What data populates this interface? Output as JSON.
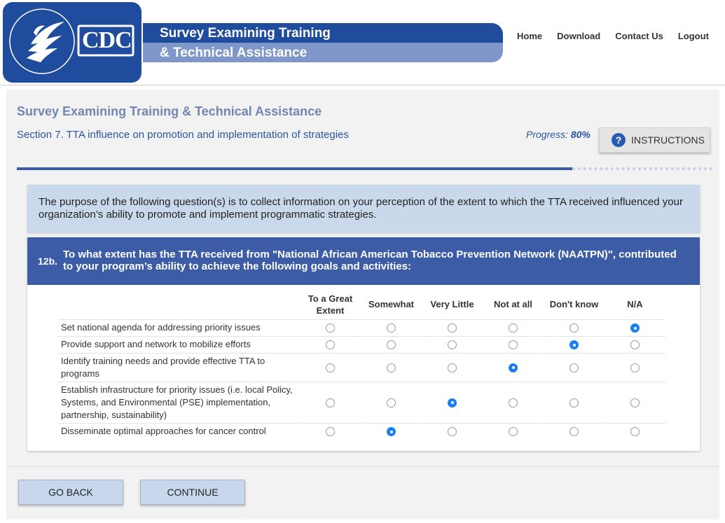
{
  "header": {
    "logo_alt": "HHS / CDC",
    "logo_text": "CDC",
    "seal_text": "DEPARTMENT OF HEALTH & HUMAN SERVICES USA",
    "banner_line1": "Survey Examining Training",
    "banner_line2": "& Technical Assistance",
    "nav": [
      "Home",
      "Download",
      "Contact Us",
      "Logout"
    ]
  },
  "page": {
    "title": "Survey Examining Training & Technical Assistance",
    "section": "Section 7. TTA influence on promotion and implementation of strategies",
    "progress_label": "Progress:",
    "progress_value": "80%",
    "progress_fraction": 0.8,
    "instructions_label": "INSTRUCTIONS",
    "instructions_icon": "question-circle-icon"
  },
  "purpose_text": "The purpose of the following question(s) is to collect information on your perception of the extent to which the TTA received influenced your organization’s ability to promote and implement programmatic strategies.",
  "question": {
    "number": "12b.",
    "text": "To what extent has the TTA received from \"National African American Tobacco Prevention Network (NAATPN)\", contributed to your program’s ability to achieve the following goals and activities:",
    "columns": [
      "To a Great Extent",
      "Somewhat",
      "Very Little",
      "Not at all",
      "Don't know",
      "N/A"
    ],
    "rows": [
      {
        "label": "Set national agenda for addressing priority issues",
        "selected": 5
      },
      {
        "label": "Provide support and network to mobilize efforts",
        "selected": 4
      },
      {
        "label": "Identify training needs and provide effective TTA to programs",
        "selected": 3
      },
      {
        "label": "Establish infrastructure for priority issues (i.e. local Policy, Systems, and Environmental (PSE) implementation, partnership, sustainability)",
        "selected": 2
      },
      {
        "label": "Disseminate optimal approaches for cancer control",
        "selected": 1
      }
    ]
  },
  "footer": {
    "back_label": "GO BACK",
    "continue_label": "CONTINUE"
  },
  "colors": {
    "brand_blue": "#1f4c9c",
    "banner_light": "#7f97c9",
    "question_header": "#3d5ca6",
    "radio_selected": "#1b7ff3"
  }
}
